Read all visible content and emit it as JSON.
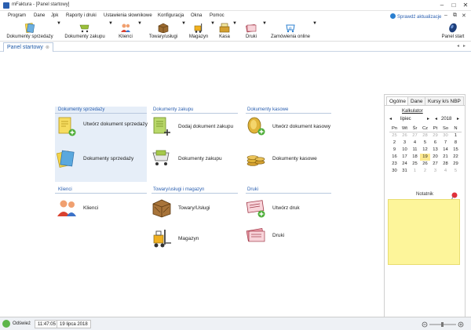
{
  "window": {
    "title": "mFaktura - [Panel startowy]",
    "controls": [
      "–",
      "□",
      "✕"
    ]
  },
  "menu": {
    "items": [
      "Program",
      "Dane",
      "Jpk",
      "Raporty i druki",
      "Ustawienia słownikowe",
      "Konfiguracja",
      "Okna",
      "Pomoc"
    ],
    "update_label": "Sprawdź aktualizacje",
    "mdi_controls": [
      "–",
      "⧉",
      "✕"
    ]
  },
  "toolbar": {
    "buttons": [
      {
        "label": "Dokumenty sprzedaży",
        "icon": "sales-documents-icon"
      },
      {
        "label": "Dokumenty zakupu",
        "icon": "purchase-documents-icon"
      },
      {
        "label": "Klienci",
        "icon": "clients-icon"
      },
      {
        "label": "Towary/usługi",
        "icon": "goods-services-icon"
      },
      {
        "label": "Magazyn",
        "icon": "warehouse-icon"
      },
      {
        "label": "Kasa",
        "icon": "cash-register-icon"
      },
      {
        "label": "Druki",
        "icon": "printouts-icon"
      },
      {
        "label": "Zamówienia online",
        "icon": "online-orders-icon"
      },
      {
        "label": "Panel start",
        "icon": "start-panel-icon"
      }
    ]
  },
  "tabs": {
    "active_label": "Panel startowy",
    "close": "⊗",
    "nav_left": "◂",
    "nav_right": "▸"
  },
  "groups": {
    "sales": {
      "title": "Dokumenty sprzedaży",
      "items": [
        "Utwórz dokument sprzedaży",
        "Dokumenty sprzedaży"
      ]
    },
    "purchase": {
      "title": "Dokumenty zakupu",
      "items": [
        "Dodaj dokument zakupu",
        "Dokumenty zakupu"
      ]
    },
    "cash": {
      "title": "Dokumenty kasowe",
      "items": [
        "Utwórz dokument kasowy",
        "Dokumenty kasowe"
      ]
    },
    "clients": {
      "title": "Klienci",
      "items": [
        "Klienci"
      ]
    },
    "goods": {
      "title": "Towary/usługi i magazyn",
      "items": [
        "Towary/Usługi",
        "Magazyn"
      ]
    },
    "prints": {
      "title": "Druki",
      "items": [
        "Utwórz druk",
        "Druki"
      ]
    }
  },
  "side_panel": {
    "tabs": [
      "Ogólne",
      "Dane",
      "Kursy k/s NBP"
    ],
    "calendar_title": "Kalkulator",
    "month": "lipiec",
    "year": "2018",
    "weekdays": [
      "Pn",
      "Wt",
      "Śr",
      "Cz",
      "Pt",
      "So",
      "N"
    ],
    "weeks": [
      [
        "25",
        "26",
        "27",
        "28",
        "29",
        "30",
        "1"
      ],
      [
        "2",
        "3",
        "4",
        "5",
        "6",
        "7",
        "8"
      ],
      [
        "9",
        "10",
        "11",
        "12",
        "13",
        "14",
        "15"
      ],
      [
        "16",
        "17",
        "18",
        "19",
        "20",
        "21",
        "22"
      ],
      [
        "23",
        "24",
        "25",
        "26",
        "27",
        "28",
        "29"
      ],
      [
        "30",
        "31",
        "1",
        "2",
        "3",
        "4",
        "5"
      ]
    ],
    "selected_day": "19",
    "notes_title": "Notatnik"
  },
  "status": {
    "refresh_label": "Odśwież",
    "time": "11:47:05",
    "date": "19 lipca 2018"
  },
  "colors": {
    "accent": "#2a5fb0",
    "selected_group": "#e6eef8",
    "note": "#fdf59a"
  }
}
